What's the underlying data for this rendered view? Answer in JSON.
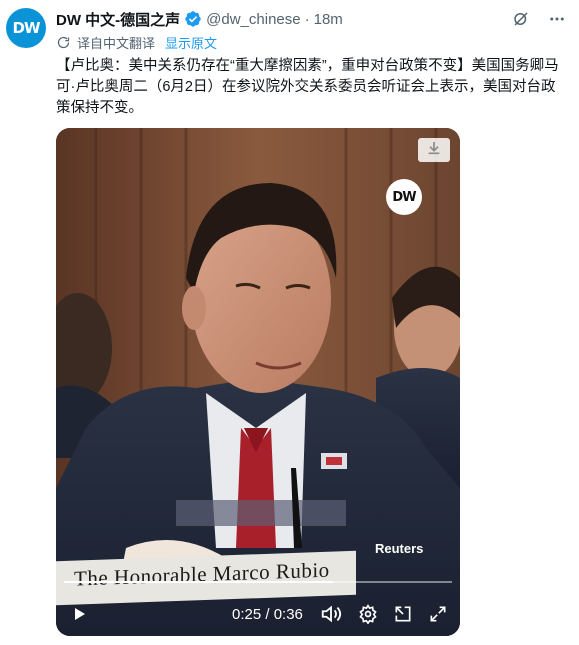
{
  "author": {
    "name": "DW 中文-德国之声",
    "handle": "@dw_chinese",
    "separator": "·",
    "time": "18m",
    "avatar_logo": "DW",
    "verified": true
  },
  "translate": {
    "label": "译自中文翻译",
    "show_original": "显示原文"
  },
  "post": {
    "text": "【卢比奥：美中关系仍存在“重大摩擦因素”，重申对台政策不变】美国国务卿马可·卢比奥周二（6月2日）在参议院外交关系委员会听证会上表示，美国对台政策保持不变。"
  },
  "video": {
    "watermark_logo": "DW",
    "credit": "Reuters",
    "nameplate": "The Honorable Marco Rubio",
    "current_time": "0:25",
    "duration": "0:36",
    "timecode": "0:25 / 0:36",
    "progress": 0.694
  },
  "icons": {
    "verified": "verified-badge-icon",
    "grok": "grok-icon",
    "more": "more-icon",
    "translate": "translate-icon",
    "download": "download-icon",
    "play": "play-icon",
    "volume": "volume-icon",
    "settings": "gear-icon",
    "pip": "picture-in-picture-icon",
    "fullscreen": "fullscreen-icon"
  },
  "colors": {
    "accent": "#1d9bf0",
    "avatar_bg": "#0b93d8",
    "muted_text": "#536471"
  }
}
